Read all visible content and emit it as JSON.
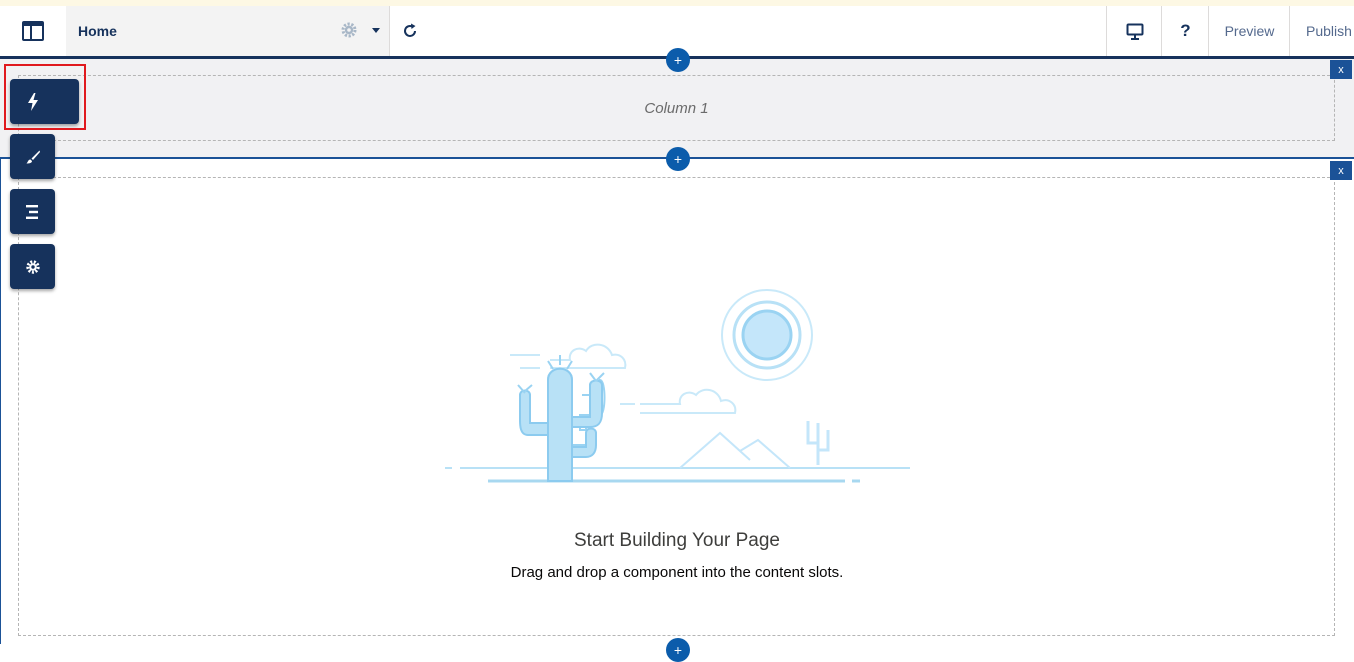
{
  "toolbar": {
    "page_name": "Home",
    "preview_label": "Preview",
    "publish_label": "Publish",
    "help_label": "?"
  },
  "sidebar": {
    "buttons": [
      {
        "icon": "lightning-bolt-icon",
        "active": true
      },
      {
        "icon": "paintbrush-icon"
      },
      {
        "icon": "page-structure-icon"
      },
      {
        "icon": "gear-icon"
      }
    ]
  },
  "canvas": {
    "column_label": "Column 1",
    "close_label": "x",
    "add_label": "+",
    "empty_title": "Start Building Your Page",
    "empty_subtitle": "Drag and drop a component into the content slots."
  },
  "colors": {
    "brand_navy": "#16325c",
    "accent_blue": "#0b5cab",
    "highlight_red": "#e0191e",
    "illustration_blue": "#a8d8f0"
  }
}
